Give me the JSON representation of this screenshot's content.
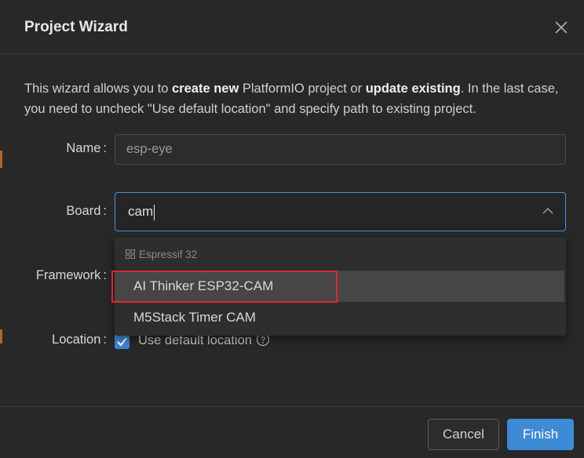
{
  "dialog": {
    "title": "Project Wizard",
    "close_icon": "close-icon"
  },
  "description": {
    "part1": "This wizard allows you to ",
    "bold1": "create new",
    "part2": " PlatformIO project or ",
    "bold2": "update existing",
    "part3": ". In the last case, you need to uncheck \"Use default location\" and specify path to existing project."
  },
  "form": {
    "name_label": "Name",
    "name_value": "esp-eye",
    "board_label": "Board",
    "board_value": "cam",
    "framework_label": "Framework",
    "location_label": "Location",
    "colon": ":"
  },
  "board_dropdown": {
    "group_header": "Espressif 32",
    "group_icon": "grid-icon",
    "options": [
      {
        "label": "AI Thinker ESP32-CAM",
        "active": true
      },
      {
        "label": "M5Stack Timer CAM",
        "active": false
      }
    ]
  },
  "location": {
    "checkbox_checked": true,
    "checkbox_label": "Use default location",
    "help_icon": "help-icon"
  },
  "footer": {
    "cancel_label": "Cancel",
    "finish_label": "Finish"
  },
  "colors": {
    "accent": "#3d8ad6",
    "highlight": "#e0262f",
    "background": "#282828"
  }
}
